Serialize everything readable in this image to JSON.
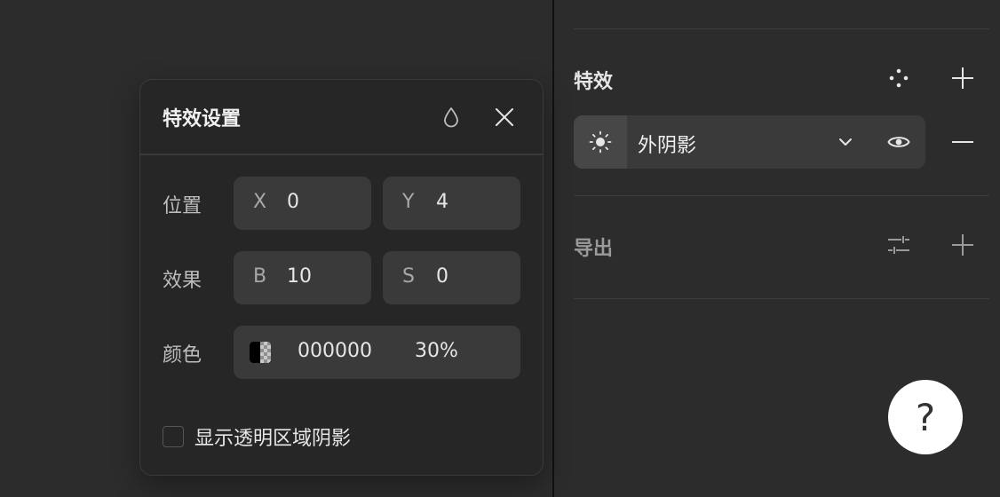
{
  "effects_section": {
    "title": "特效",
    "effect_item": {
      "name": "外阴影"
    }
  },
  "export_section": {
    "title": "导出"
  },
  "dialog": {
    "title": "特效设置",
    "position": {
      "label": "位置",
      "x_prefix": "X",
      "x_value": "0",
      "y_prefix": "Y",
      "y_value": "4"
    },
    "effect": {
      "label": "效果",
      "b_prefix": "B",
      "b_value": "10",
      "s_prefix": "S",
      "s_value": "0"
    },
    "color": {
      "label": "颜色",
      "hex": "000000",
      "opacity": "30%"
    },
    "transparent_shadow_label": "显示透明区域阴影"
  },
  "help_button": {
    "label": "?"
  }
}
